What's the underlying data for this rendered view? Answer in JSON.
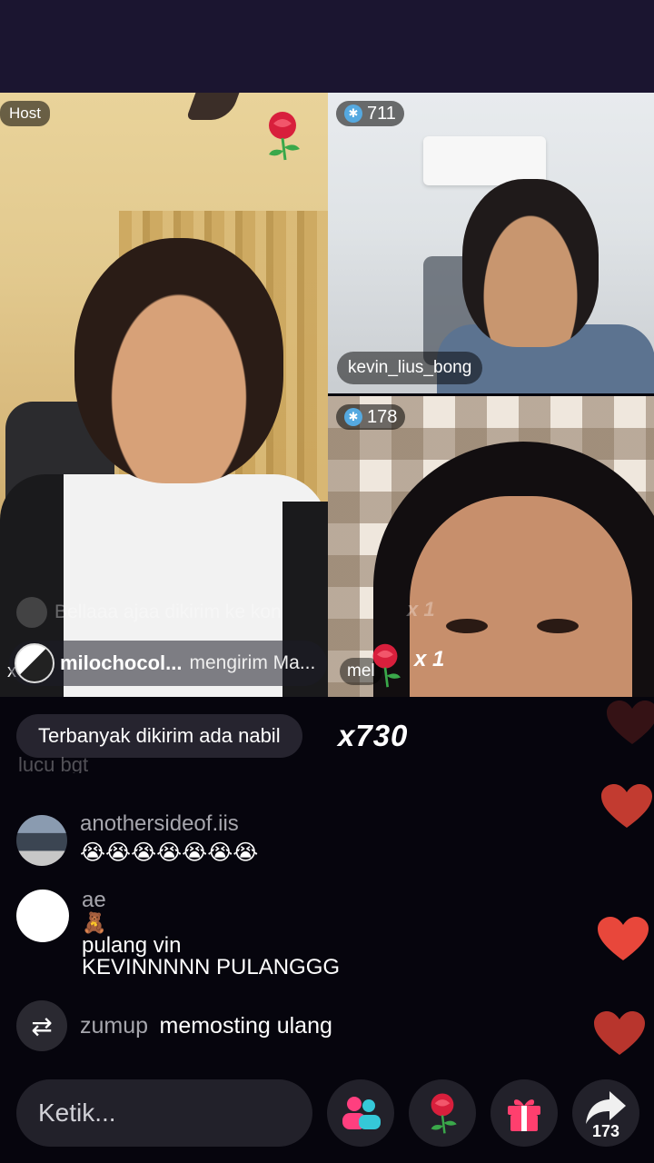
{
  "grid": {
    "host_badge": "Host",
    "top_right": {
      "count": "711",
      "username": "kevin_lius_bong"
    },
    "bottom_right": {
      "count": "178"
    }
  },
  "gift": {
    "ghost_text": "Bellaaa ajaa dikirim ke kon",
    "ghost_count": "x 1",
    "sender": "milochocol...",
    "message": "mengirim Ma...",
    "mel_tag": "mel",
    "count": "x 1",
    "close": "x"
  },
  "chat": {
    "top_pill": "Terbanyak dikirim ada nabil",
    "top_count": "x730",
    "faded_text": "lucu bgt",
    "messages": [
      {
        "user": "anothersideof.iis",
        "text": "😭😭😭😭😭😭😭"
      },
      {
        "user": "ae",
        "badge": "🧸",
        "text1": "pulang vin",
        "text2": "KEVINNNNN PULANGGG"
      }
    ],
    "share": {
      "user": "zumup",
      "text": "memosting ulang"
    }
  },
  "bottom": {
    "input_placeholder": "Ketik...",
    "share_count": "173"
  },
  "colors": {
    "topbar": "#1b1530",
    "background": "#06050d",
    "heart": "#e8473b",
    "rose": "#d81f3c"
  }
}
